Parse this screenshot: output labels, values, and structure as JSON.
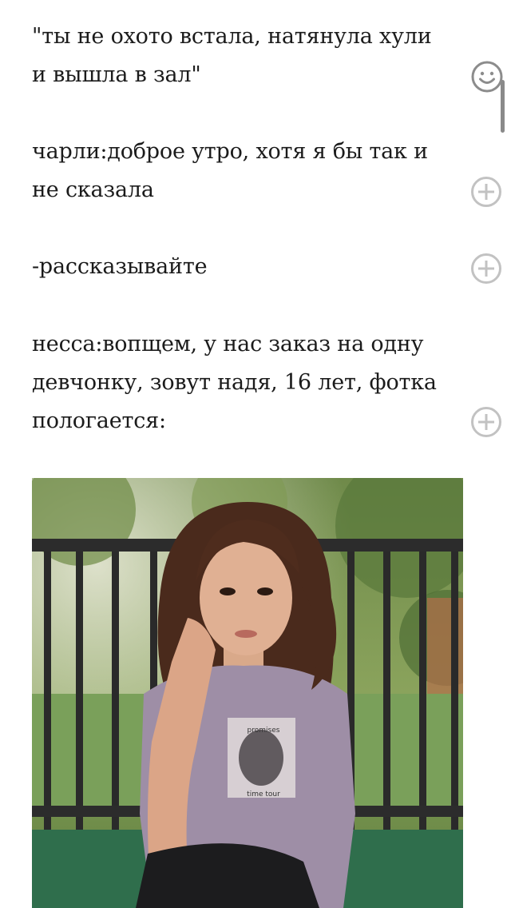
{
  "paragraphs": [
    {
      "text": "\"ты не охото встала, натянула хули\nи вышла в зал\""
    },
    {
      "text": "чарли:доброе утро, хотя я бы так и\nне сказала"
    },
    {
      "text": "-рассказывайте"
    },
    {
      "text": "несса:вопщем, у нас заказ на одну\nдевчонку, зовут надя, 16 лет, фотка\nпологается:"
    }
  ],
  "image": {
    "shirt_text_top": "promises",
    "shirt_text_bottom": "time tour"
  },
  "icons": {
    "reaction": "smiley-icon",
    "comment": "plus-circle-icon"
  }
}
